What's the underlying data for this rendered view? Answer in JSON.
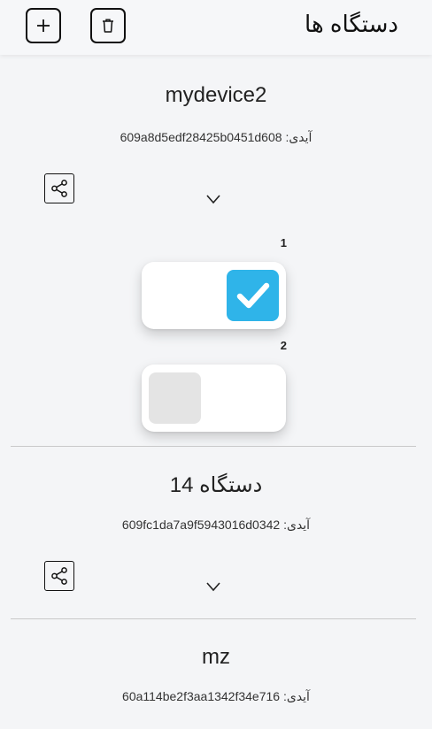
{
  "header": {
    "title": "دستگاه ها",
    "add_icon": "plus-icon",
    "delete_icon": "trash-icon"
  },
  "id_label": "آیدی:",
  "devices": [
    {
      "name": "mydevice2",
      "id": "609a8d5edf28425b0451d608",
      "switches": [
        {
          "label": "1",
          "state": "on"
        },
        {
          "label": "2",
          "state": "off"
        }
      ]
    },
    {
      "name": "دستگاه 14",
      "id": "609fc1da7a9f5943016d0342",
      "switches": []
    },
    {
      "name": "mz",
      "id": "60a114be2f3aa1342f34e716",
      "switches": []
    }
  ],
  "colors": {
    "accent": "#2fb4e9",
    "background": "#f4f5f7",
    "switch_off": "#e4e4e4"
  }
}
